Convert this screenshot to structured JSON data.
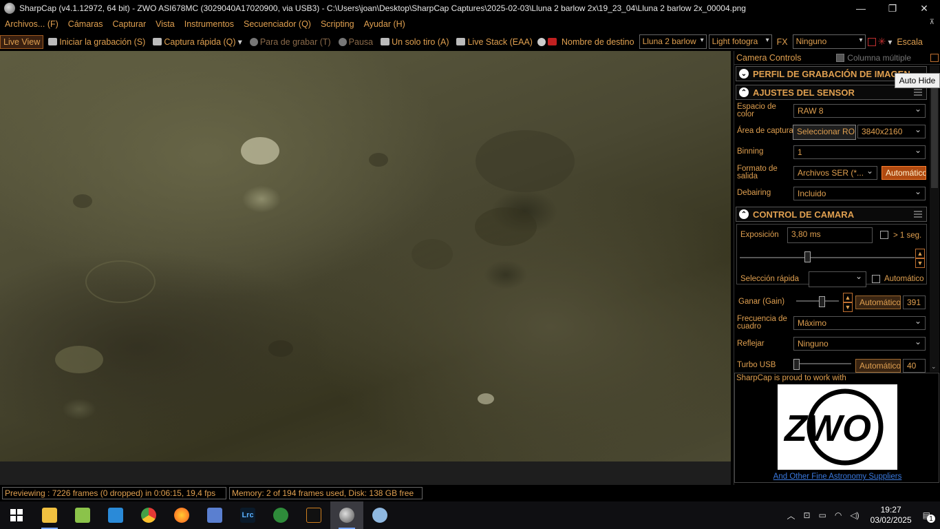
{
  "window": {
    "title": "SharpCap (v4.1.12972, 64 bit) - ZWO ASI678MC (3029040A17020900, via USB3) - C:\\Users\\joan\\Desktop\\SharpCap Captures\\2025-02-03\\Lluna 2 barlow 2x\\19_23_04\\Lluna 2 barlow 2x_00004.png",
    "minimize": "—",
    "maximize": "❐",
    "close": "✕"
  },
  "menu": [
    "Archivos... (F)",
    "Cámaras",
    "Capturar",
    "Vista",
    "Instrumentos",
    "Secuenciador (Q)",
    "Scripting",
    "Ayudar (H)"
  ],
  "toolbar": {
    "live_view": "Live View",
    "start_capture": "Iniciar la grabación (S)",
    "quick_capture": "Captura rápida (Q)",
    "stop_recording": "Para de grabar (T)",
    "pause": "Pausa",
    "single_shot": "Un solo tiro (A)",
    "live_stack": "Live Stack (EAA)",
    "target_name_label": "Nombre de destino",
    "target_name_value": "Lluna 2 barlow",
    "frame_type": "Light fotogra",
    "fx_label": "FX",
    "fx_value": "Ninguno",
    "scale_label": "Escala"
  },
  "panel": {
    "title": "Camera Controls",
    "multi_column": "Columna múltiple",
    "tooltip": "Auto Hide",
    "sections": {
      "profile": "PERFIL DE GRABACIÓN DE IMAGEN",
      "sensor": "AJUSTES DEL SENSOR",
      "camera": "CONTROL DE CAMARA"
    },
    "sensor": {
      "color_space_label": "Espacio de color",
      "color_space_value": "RAW 8",
      "capture_area_label": "Área de captura",
      "select_roi": "Seleccionar ROI",
      "capture_area_value": "3840x2160",
      "binning_label": "Binning",
      "binning_value": "1",
      "output_format_label": "Formato de salida",
      "output_format_value": "Archivos SER (*...",
      "output_auto": "Automático",
      "debayer_label": "Debairing",
      "debayer_value": "Incluido"
    },
    "camera": {
      "exposure_label": "Exposición",
      "exposure_value": "3,80 ms",
      "over_one_sec": "> 1 seg.",
      "quick_select_label": "Selección rápida",
      "quick_select_value": "",
      "quick_auto": "Automático",
      "gain_label": "Ganar (Gain)",
      "gain_auto": "Automático",
      "gain_value": "391",
      "frame_rate_label": "Frecuencia de cuadro",
      "frame_rate_value": "Máximo",
      "flip_label": "Reflejar",
      "flip_value": "Ninguno",
      "turbo_label": "Turbo USB",
      "turbo_auto": "Automático",
      "turbo_value": "40"
    },
    "ad": {
      "text": "SharpCap is proud to work with",
      "logo": "ZWO",
      "link": "And Other Fine Astronomy Suppliers"
    }
  },
  "status": {
    "preview": "Previewing : 7226 frames (0 dropped) in 0:06:15, 19,4 fps",
    "memory": "Memory: 2 of 194 frames used, Disk: 138 GB free"
  },
  "taskbar": {
    "time": "19:27",
    "date": "03/02/2025",
    "notifications": "1",
    "apps": [
      "windows-start",
      "file-explorer",
      "notepad-plus",
      "vscode",
      "chrome",
      "firefox",
      "network-tool",
      "lightroom-classic",
      "green-app",
      "curve-app",
      "sharpcap",
      "paint-app"
    ],
    "lrc_label": "Lrc"
  }
}
